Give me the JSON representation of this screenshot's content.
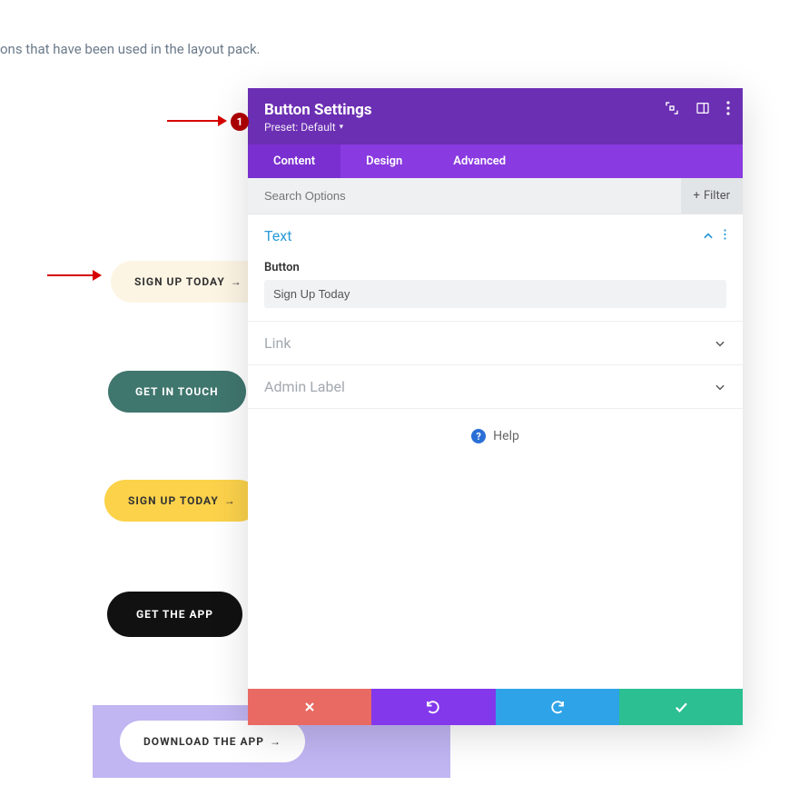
{
  "background": {
    "partial_text": "ons that have been used in the layout pack."
  },
  "annotations": {
    "badge_1": "1"
  },
  "buttons": {
    "sign_up_1": "SIGN UP TODAY",
    "get_in_touch": "GET IN TOUCH",
    "sign_up_2": "SIGN UP TODAY",
    "get_the_app": "GET THE APP",
    "download": "DOWNLOAD THE APP",
    "arrow_glyph": "→"
  },
  "modal": {
    "title": "Button Settings",
    "preset_label": "Preset:",
    "preset_value": "Default",
    "tabs": {
      "content": "Content",
      "design": "Design",
      "advanced": "Advanced"
    },
    "search_placeholder": "Search Options",
    "filter_label": "Filter",
    "sections": {
      "text": {
        "title": "Text",
        "field_label": "Button",
        "field_value": "Sign Up Today"
      },
      "link": {
        "title": "Link"
      },
      "admin": {
        "title": "Admin Label"
      }
    },
    "help_label": "Help"
  }
}
